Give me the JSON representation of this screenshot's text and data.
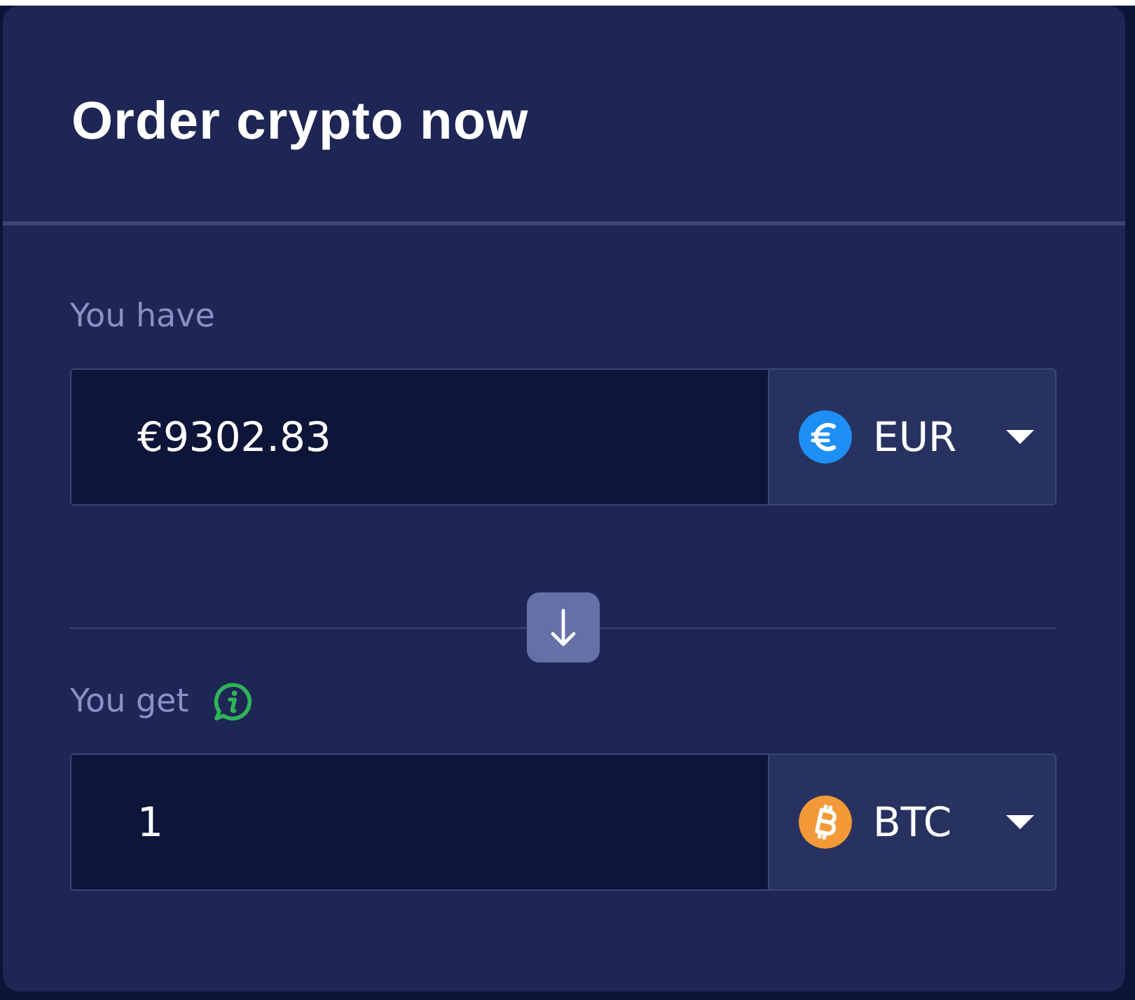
{
  "card": {
    "title": "Order crypto now",
    "fields": [
      {
        "label": "You have",
        "info": false,
        "value": "€9302.83",
        "currency": {
          "kind": "euro",
          "code": "EUR"
        }
      },
      {
        "label": "You get",
        "info": true,
        "value": "1",
        "currency": {
          "kind": "bitcoin",
          "code": "BTC"
        }
      }
    ]
  }
}
